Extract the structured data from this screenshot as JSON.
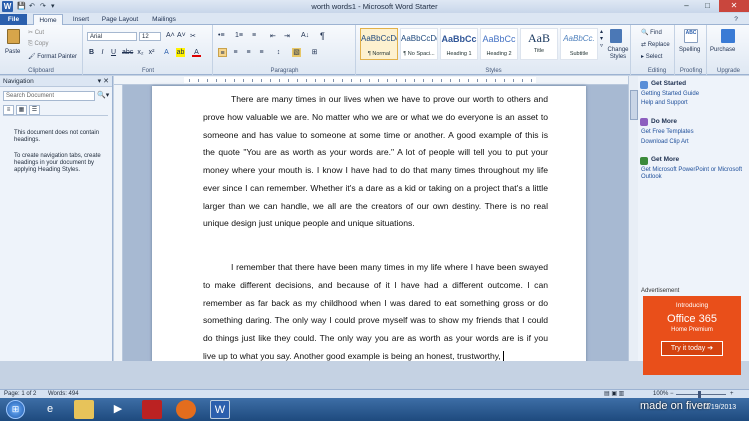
{
  "window": {
    "title": "worth words1 - Microsoft Word Starter",
    "app_logo": "W"
  },
  "tabs": [
    "File",
    "Home",
    "Insert",
    "Page Layout",
    "Mailings"
  ],
  "clipboard": {
    "paste": "Paste",
    "cut": "Cut",
    "copy": "Copy",
    "format_painter": "Format Painter",
    "label": "Clipboard"
  },
  "font": {
    "name": "Arial",
    "size": "12",
    "label": "Font"
  },
  "paragraph": {
    "label": "Paragraph"
  },
  "styles": {
    "label": "Styles",
    "items": [
      {
        "preview": "AaBbCcDc",
        "name": "¶ Normal"
      },
      {
        "preview": "AaBbCcDc",
        "name": "¶ No Spaci..."
      },
      {
        "preview": "AaBbCc",
        "name": "Heading 1"
      },
      {
        "preview": "AaBbCc",
        "name": "Heading 2"
      },
      {
        "preview": "AaB",
        "name": "Title"
      },
      {
        "preview": "AaBbCc.",
        "name": "Subtitle"
      }
    ],
    "change_styles": "Change Styles"
  },
  "editing": {
    "find": "Find",
    "replace": "Replace",
    "select": "Select",
    "label": "Editing"
  },
  "proofing": {
    "spelling": "Spelling",
    "label": "Proofing"
  },
  "upgrade": {
    "purchase": "Purchase",
    "label": "Upgrade"
  },
  "navigation": {
    "title": "Navigation",
    "search_placeholder": "Search Document",
    "msg1": "This document does not contain headings.",
    "msg2": "To create navigation tabs, create headings in your document by applying Heading Styles."
  },
  "document": {
    "paragraph1": "There are many times in our lives when we have to prove our worth to others and prove how valuable we are. No matter who we are or what we do everyone is an asset to someone and has value to someone at some time or another. A good example of this is the quote \"You are as worth as your words are.\" A lot of people will tell you to put your money where your mouth is. I know I have had to do that many times throughout my life ever since I can remember. Whether it's a dare as a kid or taking on a project that's a little larger than we can handle, we all are the creators of our own destiny. There is no real unique design just unique people and unique situations.",
    "paragraph2": "I remember that there have been many times in my life where I have been swayed to make different decisions, and because of it I have had a different outcome. I can remember as far back as my childhood when I was dared to eat something gross or do something daring. The only way I could prove myself was to show my friends that I could do things just like they could. The only way you are as worth as your words are is if you live up to what you say. Another good example is being an honest, trustworthy,"
  },
  "taskpane": {
    "started": "Get Started",
    "started_links": [
      "Getting Started Guide",
      "Help and Support"
    ],
    "more": "Do More",
    "more_links": [
      "Get Free Templates",
      "Download Clip Art"
    ],
    "getmore": "Get More",
    "getmore_links": [
      "Get Microsoft PowerPoint or Microsoft Outlook"
    ],
    "ad_label": "Advertisement",
    "ad_intro": "Introducing",
    "ad_name": "Office 365",
    "ad_sub": "Home Premium",
    "ad_button": "Try it today"
  },
  "status": {
    "page": "Page: 1 of 2",
    "words": "Words: 494",
    "zoom": "100%"
  },
  "taskbar": {
    "date": "2/19/2013"
  },
  "watermark": "made on fiverr",
  "colors": {
    "accent": "#2b5fad",
    "ad": "#e94f1a"
  }
}
